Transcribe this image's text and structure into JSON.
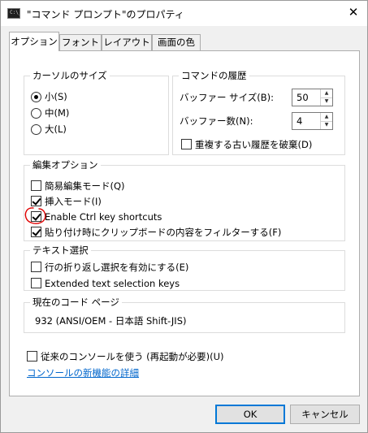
{
  "window": {
    "title": "\"コマンド プロンプト\"のプロパティ",
    "icon_text": "C:\\_",
    "close_glyph": "✕"
  },
  "tabs": [
    {
      "label": "オプション",
      "active": true
    },
    {
      "label": "フォント"
    },
    {
      "label": "レイアウト"
    },
    {
      "label": "画面の色"
    }
  ],
  "cursor_size": {
    "legend": "カーソルのサイズ",
    "options": [
      {
        "label": "小(S)",
        "selected": true
      },
      {
        "label": "中(M)",
        "selected": false
      },
      {
        "label": "大(L)",
        "selected": false
      }
    ]
  },
  "history": {
    "legend": "コマンドの履歴",
    "buffer_size_label": "バッファー サイズ(B):",
    "buffer_size_value": "50",
    "buffer_count_label": "バッファー数(N):",
    "buffer_count_value": "4",
    "discard_dup_label": "重複する古い履歴を破棄(D)",
    "discard_dup_checked": false
  },
  "edit_options": {
    "legend": "編集オプション",
    "items": [
      {
        "label": "簡易編集モード(Q)",
        "checked": false
      },
      {
        "label": "挿入モード(I)",
        "checked": true
      },
      {
        "label": "Enable Ctrl key shortcuts",
        "checked": true
      },
      {
        "label": "貼り付け時にクリップボードの内容をフィルターする(F)",
        "checked": true
      }
    ]
  },
  "text_selection": {
    "legend": "テキスト選択",
    "items": [
      {
        "label": "行の折り返し選択を有効にする(E)",
        "checked": false
      },
      {
        "label": "Extended text selection keys",
        "checked": false
      }
    ]
  },
  "code_page": {
    "legend": "現在のコード ページ",
    "value": "932   (ANSI/OEM - 日本語 Shift-JIS)"
  },
  "legacy_console": {
    "label": "従来のコンソールを使う (再起動が必要)(U)",
    "checked": false
  },
  "more_info_link": "コンソールの新機能の詳細",
  "buttons": {
    "ok": "OK",
    "cancel": "キャンセル"
  },
  "colors": {
    "accent": "#0078d7",
    "link": "#0066cc",
    "annotation": "#e00000"
  }
}
